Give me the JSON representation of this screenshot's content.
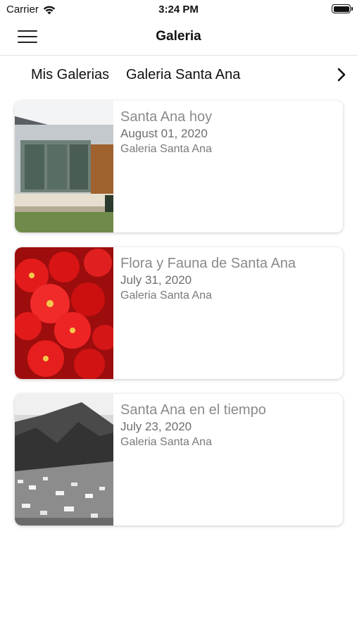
{
  "status_bar": {
    "carrier": "Carrier",
    "time": "3:24 PM"
  },
  "nav": {
    "title": "Galeria"
  },
  "breadcrumb": {
    "items": [
      "Mis Galerias",
      "Galeria Santa Ana"
    ]
  },
  "galleries": [
    {
      "title": "Santa Ana hoy",
      "date": "August 01, 2020",
      "source": "Galeria Santa Ana",
      "thumbnail": "building-photo"
    },
    {
      "title": "Flora y Fauna de Santa Ana",
      "date": "July 31, 2020",
      "source": "Galeria Santa Ana",
      "thumbnail": "red-flowers-photo"
    },
    {
      "title": "Santa Ana en el tiempo",
      "date": "July 23, 2020",
      "source": "Galeria Santa Ana",
      "thumbnail": "mountain-town-photo"
    }
  ]
}
